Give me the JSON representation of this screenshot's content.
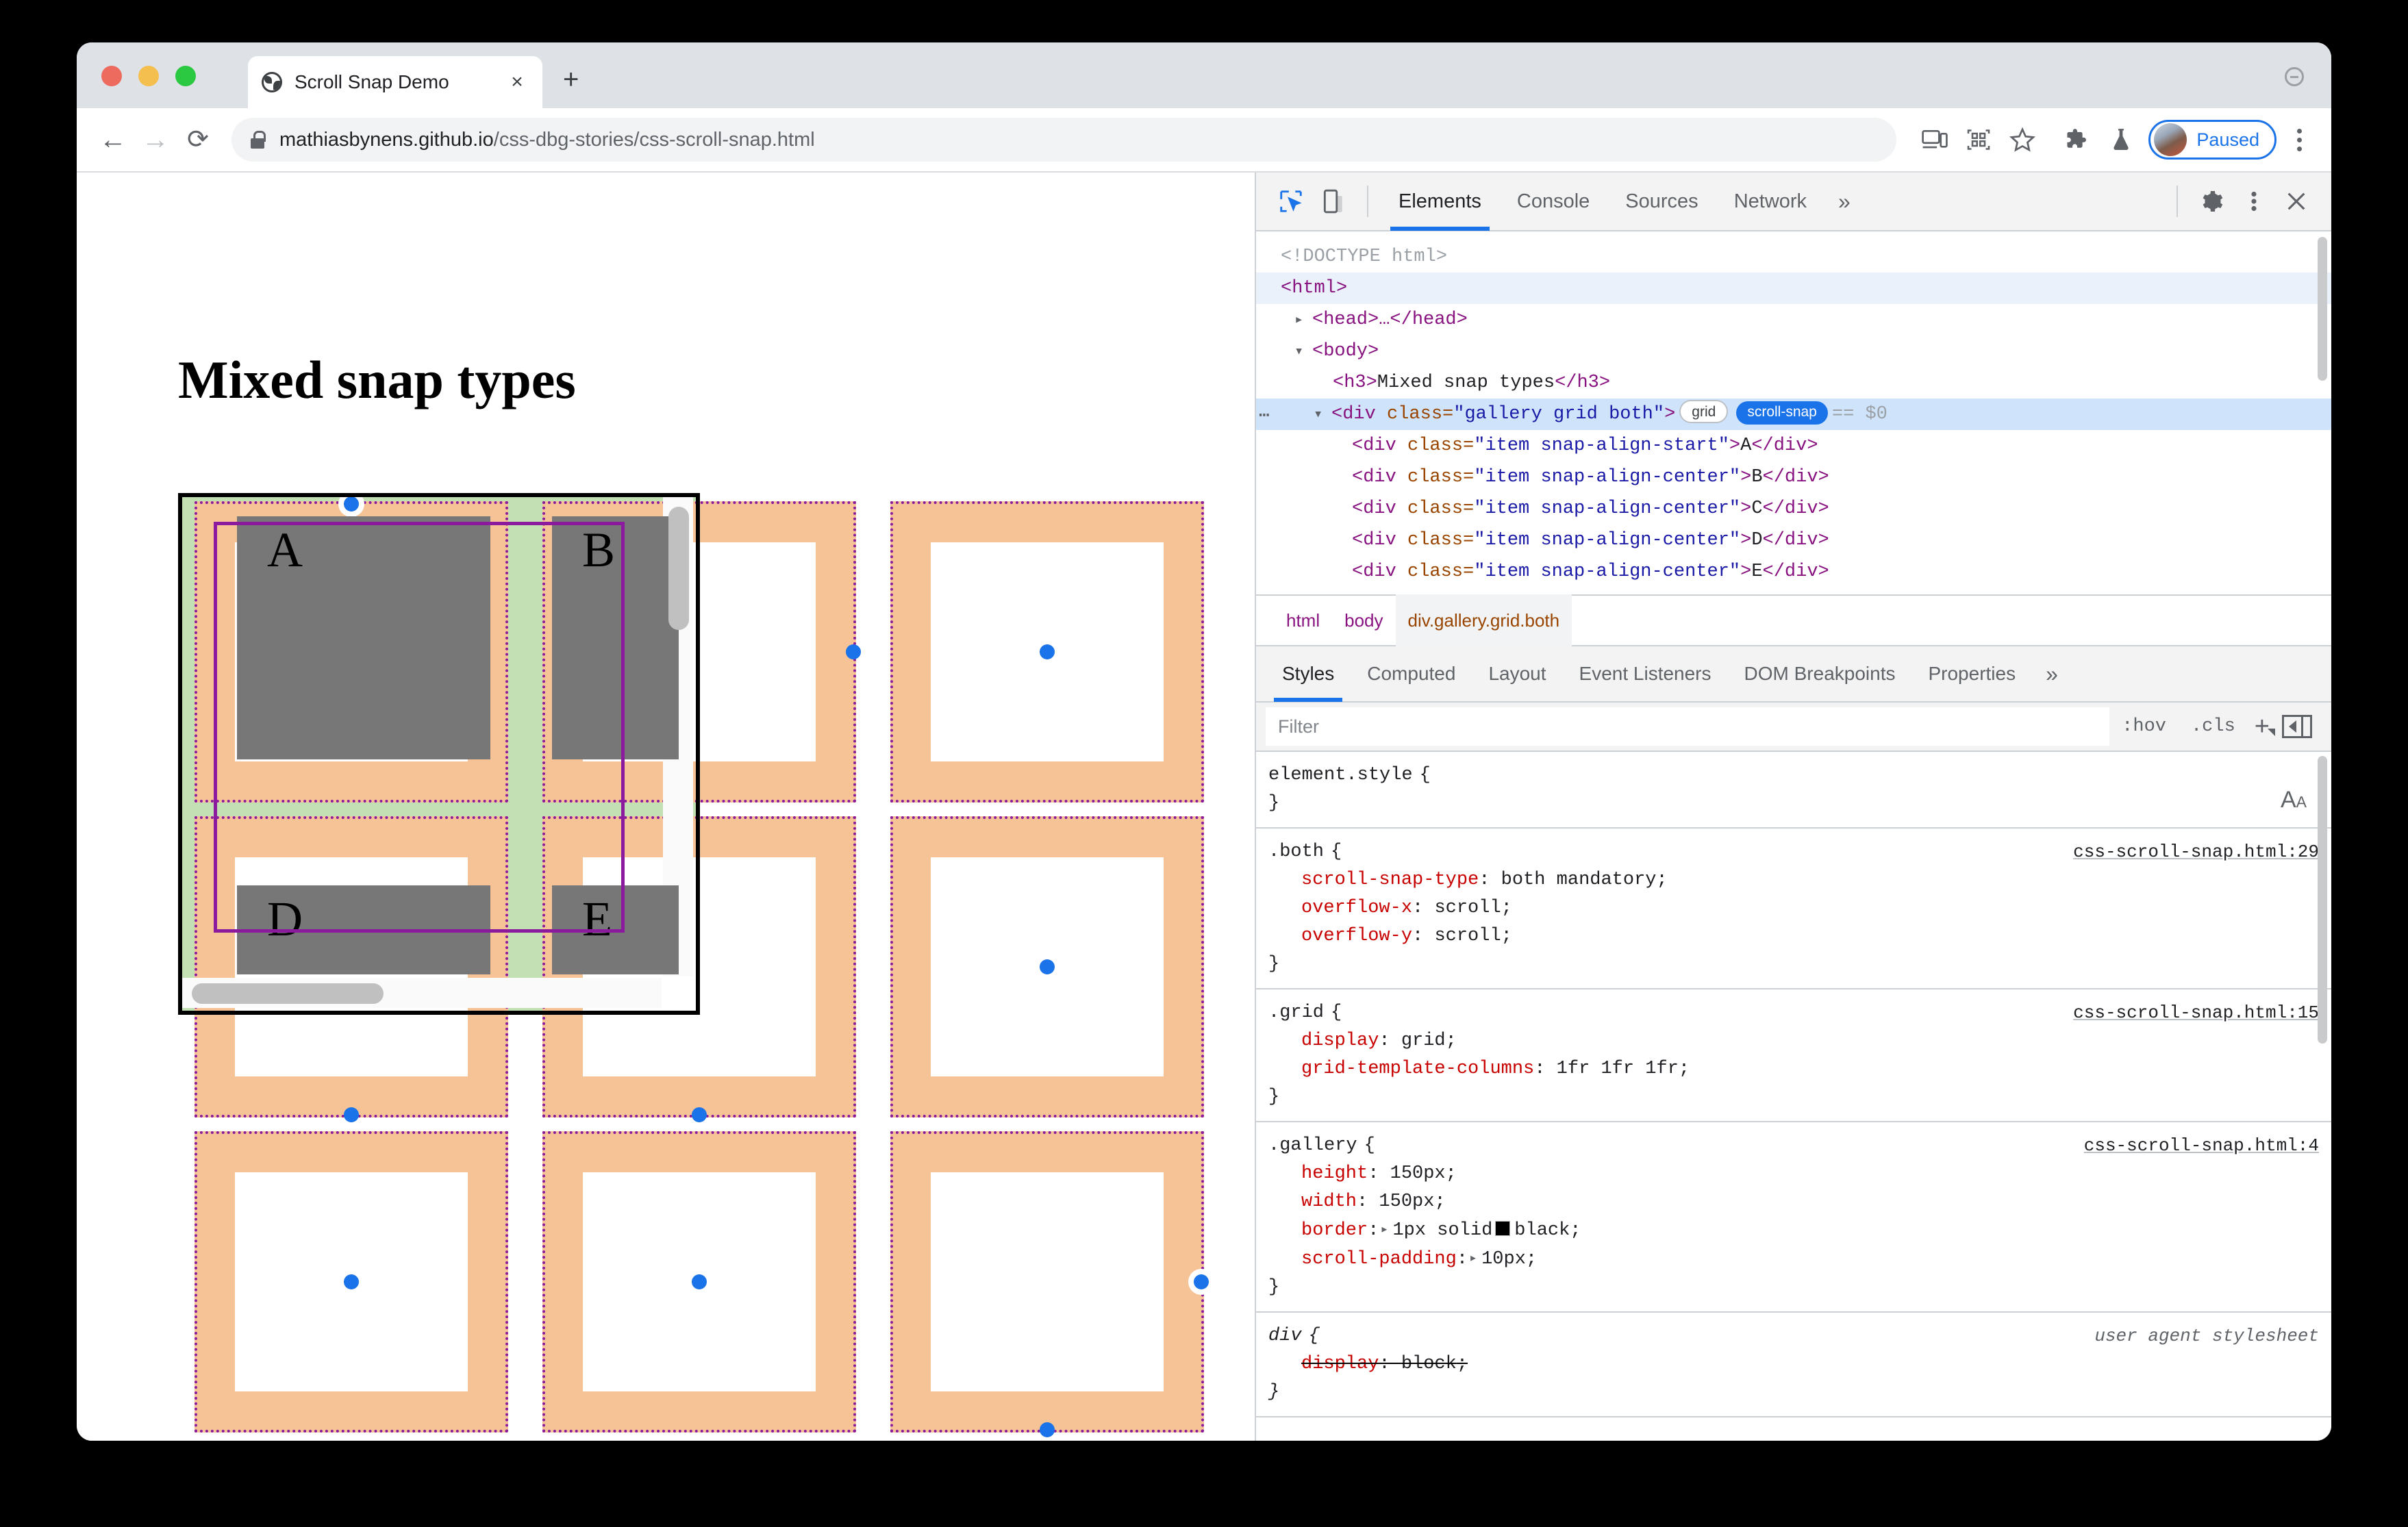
{
  "window": {
    "tab": {
      "title": "Scroll Snap Demo",
      "close_label": "×",
      "favicon": "globe-icon"
    },
    "new_tab_label": "+",
    "traffic_lights": [
      "close",
      "minimize",
      "maximize"
    ]
  },
  "toolbar": {
    "back_label": "←",
    "forward_label": "→",
    "reload_label": "⟳",
    "url_host": "mathiasbynens.github.io",
    "url_path": "/css-dbg-stories/css-scroll-snap.html",
    "icons": [
      "cast-icon",
      "qr-code-icon",
      "bookmark-star-icon",
      "extensions-puzzle-icon",
      "beaker-icon"
    ],
    "profile_label": "Paused",
    "menu_label": "⋮"
  },
  "page": {
    "heading": "Mixed snap types",
    "items": [
      {
        "label": "A",
        "align": "start"
      },
      {
        "label": "B",
        "align": "center"
      },
      {
        "label": "D",
        "align": "center"
      },
      {
        "label": "E",
        "align": "center"
      }
    ],
    "snap_areas": [
      {
        "dot": "top"
      },
      {
        "dot": "right"
      },
      {
        "dot": "center"
      },
      {
        "dot": "bottom"
      },
      {
        "dot": "bottom"
      },
      {
        "dot": "center"
      },
      {
        "dot": "center"
      },
      {
        "dot": "center"
      },
      {
        "dot": "right"
      }
    ],
    "overlay_colors": {
      "snap_area_fill": "#f5c396",
      "snap_area_border": "#8b1a9e",
      "scroll_padding": "#c3e0b4",
      "snap_point": "#1a73e8",
      "container_border": "#000000",
      "item_fill": "#777777"
    }
  },
  "devtools": {
    "tools": [
      "inspect-icon",
      "device-toolbar-icon"
    ],
    "tabs": [
      {
        "label": "Elements",
        "active": true
      },
      {
        "label": "Console",
        "active": false
      },
      {
        "label": "Sources",
        "active": false
      },
      {
        "label": "Network",
        "active": false
      }
    ],
    "more_tabs_label": "»",
    "right_icons": [
      "gear-icon",
      "kebab-menu-icon",
      "close-icon"
    ],
    "dom": [
      {
        "text": "<!DOCTYPE html>",
        "kind": "doctype",
        "indent": 0
      },
      {
        "text": "<html>",
        "kind": "tag",
        "indent": 0,
        "highlight": "light"
      },
      {
        "text": "<head>…</head>",
        "kind": "tag",
        "indent": 1,
        "arrow": "collapsed"
      },
      {
        "text": "<body>",
        "kind": "tag",
        "indent": 1,
        "arrow": "expanded"
      },
      {
        "tag": "h3",
        "content": "Mixed snap types",
        "indent": 2
      },
      {
        "tag": "div",
        "attr": "class",
        "value": "gallery grid both",
        "indent": 2,
        "arrow": "expanded",
        "selected": true,
        "badges": [
          "grid",
          "scroll-snap"
        ],
        "suffix": "== $0"
      },
      {
        "tag": "div",
        "attr": "class",
        "value": "item snap-align-start",
        "content": "A",
        "indent": 3
      },
      {
        "tag": "div",
        "attr": "class",
        "value": "item snap-align-center",
        "content": "B",
        "indent": 3
      },
      {
        "tag": "div",
        "attr": "class",
        "value": "item snap-align-center",
        "content": "C",
        "indent": 3
      },
      {
        "tag": "div",
        "attr": "class",
        "value": "item snap-align-center",
        "content": "D",
        "indent": 3
      },
      {
        "tag": "div",
        "attr": "class",
        "value": "item snap-align-center",
        "content": "E",
        "indent": 3
      }
    ],
    "breadcrumb": [
      {
        "label": "html",
        "active": false
      },
      {
        "label": "body",
        "active": false
      },
      {
        "label": "div.gallery.grid.both",
        "active": true
      }
    ],
    "pane_tabs": [
      {
        "label": "Styles",
        "active": true
      },
      {
        "label": "Computed",
        "active": false
      },
      {
        "label": "Layout",
        "active": false
      },
      {
        "label": "Event Listeners",
        "active": false
      },
      {
        "label": "DOM Breakpoints",
        "active": false
      },
      {
        "label": "Properties",
        "active": false
      }
    ],
    "pane_more_label": "»",
    "filter": {
      "placeholder": "Filter",
      "value": "",
      "hov_label": ":hov",
      "cls_label": ".cls",
      "add_label": "+",
      "sidebar_toggle": "sidebar-toggle-icon"
    },
    "font_size_icon": "font-size-icon",
    "rules": [
      {
        "selector": "element.style",
        "origin": "",
        "declarations": []
      },
      {
        "selector": ".both",
        "origin": "css-scroll-snap.html:29",
        "declarations": [
          {
            "prop": "scroll-snap-type",
            "value": "both mandatory"
          },
          {
            "prop": "overflow-x",
            "value": "scroll"
          },
          {
            "prop": "overflow-y",
            "value": "scroll"
          }
        ]
      },
      {
        "selector": ".grid",
        "origin": "css-scroll-snap.html:15",
        "declarations": [
          {
            "prop": "display",
            "value": "grid"
          },
          {
            "prop": "grid-template-columns",
            "value": "1fr 1fr 1fr"
          }
        ]
      },
      {
        "selector": ".gallery",
        "origin": "css-scroll-snap.html:4",
        "declarations": [
          {
            "prop": "height",
            "value": "150px"
          },
          {
            "prop": "width",
            "value": "150px"
          },
          {
            "prop": "border",
            "value": "1px solid black",
            "expandable": true,
            "swatch": "#000000"
          },
          {
            "prop": "scroll-padding",
            "value": "10px",
            "expandable": true
          }
        ]
      },
      {
        "selector": "div",
        "origin": "user agent stylesheet",
        "ua": true,
        "declarations": [
          {
            "prop": "display",
            "value": "block",
            "overridden": true
          }
        ]
      }
    ]
  }
}
